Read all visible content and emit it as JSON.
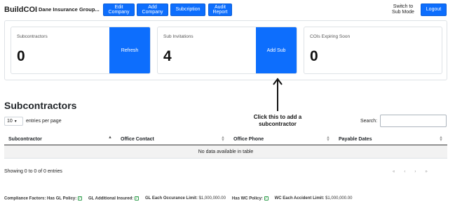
{
  "header": {
    "brand": "BuildCOI",
    "company": "Dane Insurance Group...",
    "buttons": [
      "Edit\nCompany",
      "Add\nCompany",
      "Subcription",
      "Audit\nReport"
    ],
    "switch_mode": "Switch to\nSub Mode",
    "logout": "Logout"
  },
  "stats": [
    {
      "label": "Subcontractors",
      "value": "0",
      "button": "Refresh"
    },
    {
      "label": "Sub Invitations",
      "value": "4",
      "button": "Add Sub"
    },
    {
      "label": "COIs Expiring Soon",
      "value": "0"
    }
  ],
  "annotation": "Click this to add a subcontractor",
  "section": {
    "title": "Subcontractors",
    "entries_value": "10",
    "entries_suffix": "entries per page",
    "search_label": "Search:"
  },
  "table": {
    "columns": [
      "Subcontractor",
      "Office Contact",
      "Office Phone",
      "Payable Dates"
    ],
    "empty": "No data available in table"
  },
  "footer": {
    "showing": "Showing 0 to 0 of 0 entries",
    "pager": [
      "«",
      "‹",
      "›",
      "»"
    ]
  },
  "compliance": [
    {
      "label": "Compliance Factors: Has GL Policy:",
      "value": "",
      "check": true
    },
    {
      "label": "GL Additional Insured:",
      "value": "",
      "check": true
    },
    {
      "label": "GL Each Occurance Limit:",
      "value": "$1,000,000.00",
      "check": false
    },
    {
      "label": "Has WC Policy:",
      "value": "",
      "check": true
    },
    {
      "label": "WC Each Accident Limit:",
      "value": "$1,000,000.00",
      "check": false
    }
  ],
  "colors": {
    "primary": "#0d6efd"
  }
}
